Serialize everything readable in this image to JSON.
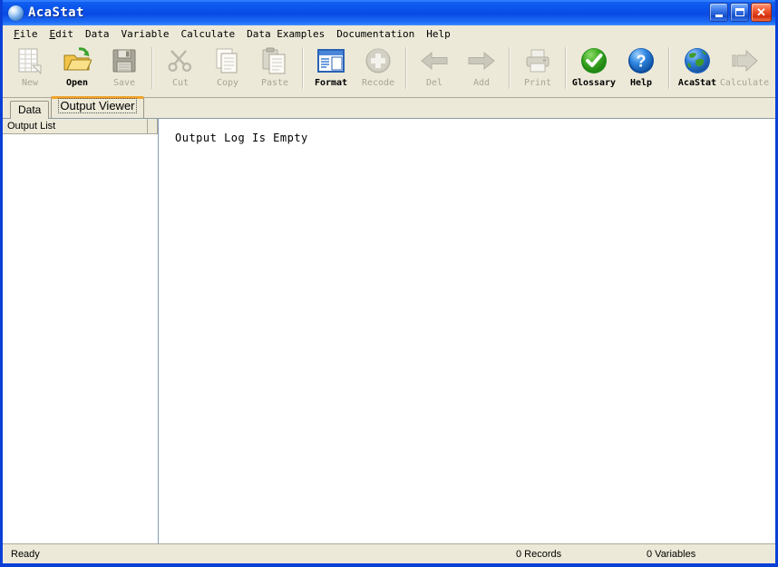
{
  "window": {
    "title": "AcaStat",
    "icon": "app-sphere-icon",
    "buttons": {
      "minimize": "Minimize",
      "maximize": "Maximize",
      "close": "Close"
    }
  },
  "menubar": {
    "items": [
      {
        "label": "File",
        "accel": "F"
      },
      {
        "label": "Edit",
        "accel": "E"
      },
      {
        "label": "Data",
        "accel": ""
      },
      {
        "label": "Variable",
        "accel": ""
      },
      {
        "label": "Calculate",
        "accel": ""
      },
      {
        "label": "Data Examples",
        "accel": ""
      },
      {
        "label": "Documentation",
        "accel": ""
      },
      {
        "label": "Help",
        "accel": ""
      }
    ]
  },
  "toolbar": {
    "buttons": [
      {
        "label": "New",
        "icon": "new-document-icon",
        "enabled": false
      },
      {
        "label": "Open",
        "icon": "open-folder-icon",
        "enabled": true
      },
      {
        "label": "Save",
        "icon": "floppy-disk-icon",
        "enabled": false
      },
      {
        "label": "Cut",
        "icon": "scissors-icon",
        "enabled": false
      },
      {
        "label": "Copy",
        "icon": "copy-pages-icon",
        "enabled": false
      },
      {
        "label": "Paste",
        "icon": "clipboard-icon",
        "enabled": false
      },
      {
        "label": "Format",
        "icon": "format-window-icon",
        "enabled": true
      },
      {
        "label": "Recode",
        "icon": "plus-circle-icon",
        "enabled": false
      },
      {
        "label": "Del",
        "icon": "arrow-left-icon",
        "enabled": false
      },
      {
        "label": "Add",
        "icon": "arrow-right-icon",
        "enabled": false
      },
      {
        "label": "Print",
        "icon": "printer-icon",
        "enabled": false
      },
      {
        "label": "Glossary",
        "icon": "green-check-circle-icon",
        "enabled": true
      },
      {
        "label": "Help",
        "icon": "blue-question-circle-icon",
        "enabled": true
      },
      {
        "label": "AcaStat",
        "icon": "globe-icon",
        "enabled": true
      },
      {
        "label": "Calculate",
        "icon": "fat-arrow-right-icon",
        "enabled": false
      }
    ]
  },
  "tabs": [
    {
      "label": "Data",
      "active": false
    },
    {
      "label": "Output Viewer",
      "active": true
    }
  ],
  "left_pane": {
    "column_header": "Output List",
    "items": []
  },
  "right_pane": {
    "message": "Output Log Is Empty"
  },
  "statusbar": {
    "state": "Ready",
    "records": "0 Records",
    "variables": "0 Variables"
  },
  "colors": {
    "titlebar_blue": "#0a4ae4",
    "window_frame": "#0a3fd6",
    "toolbar_bg": "#ece9d8",
    "active_tab_accent": "#f0a32a",
    "close_button_red": "#d22d0c",
    "disabled_text": "#a9a596"
  }
}
